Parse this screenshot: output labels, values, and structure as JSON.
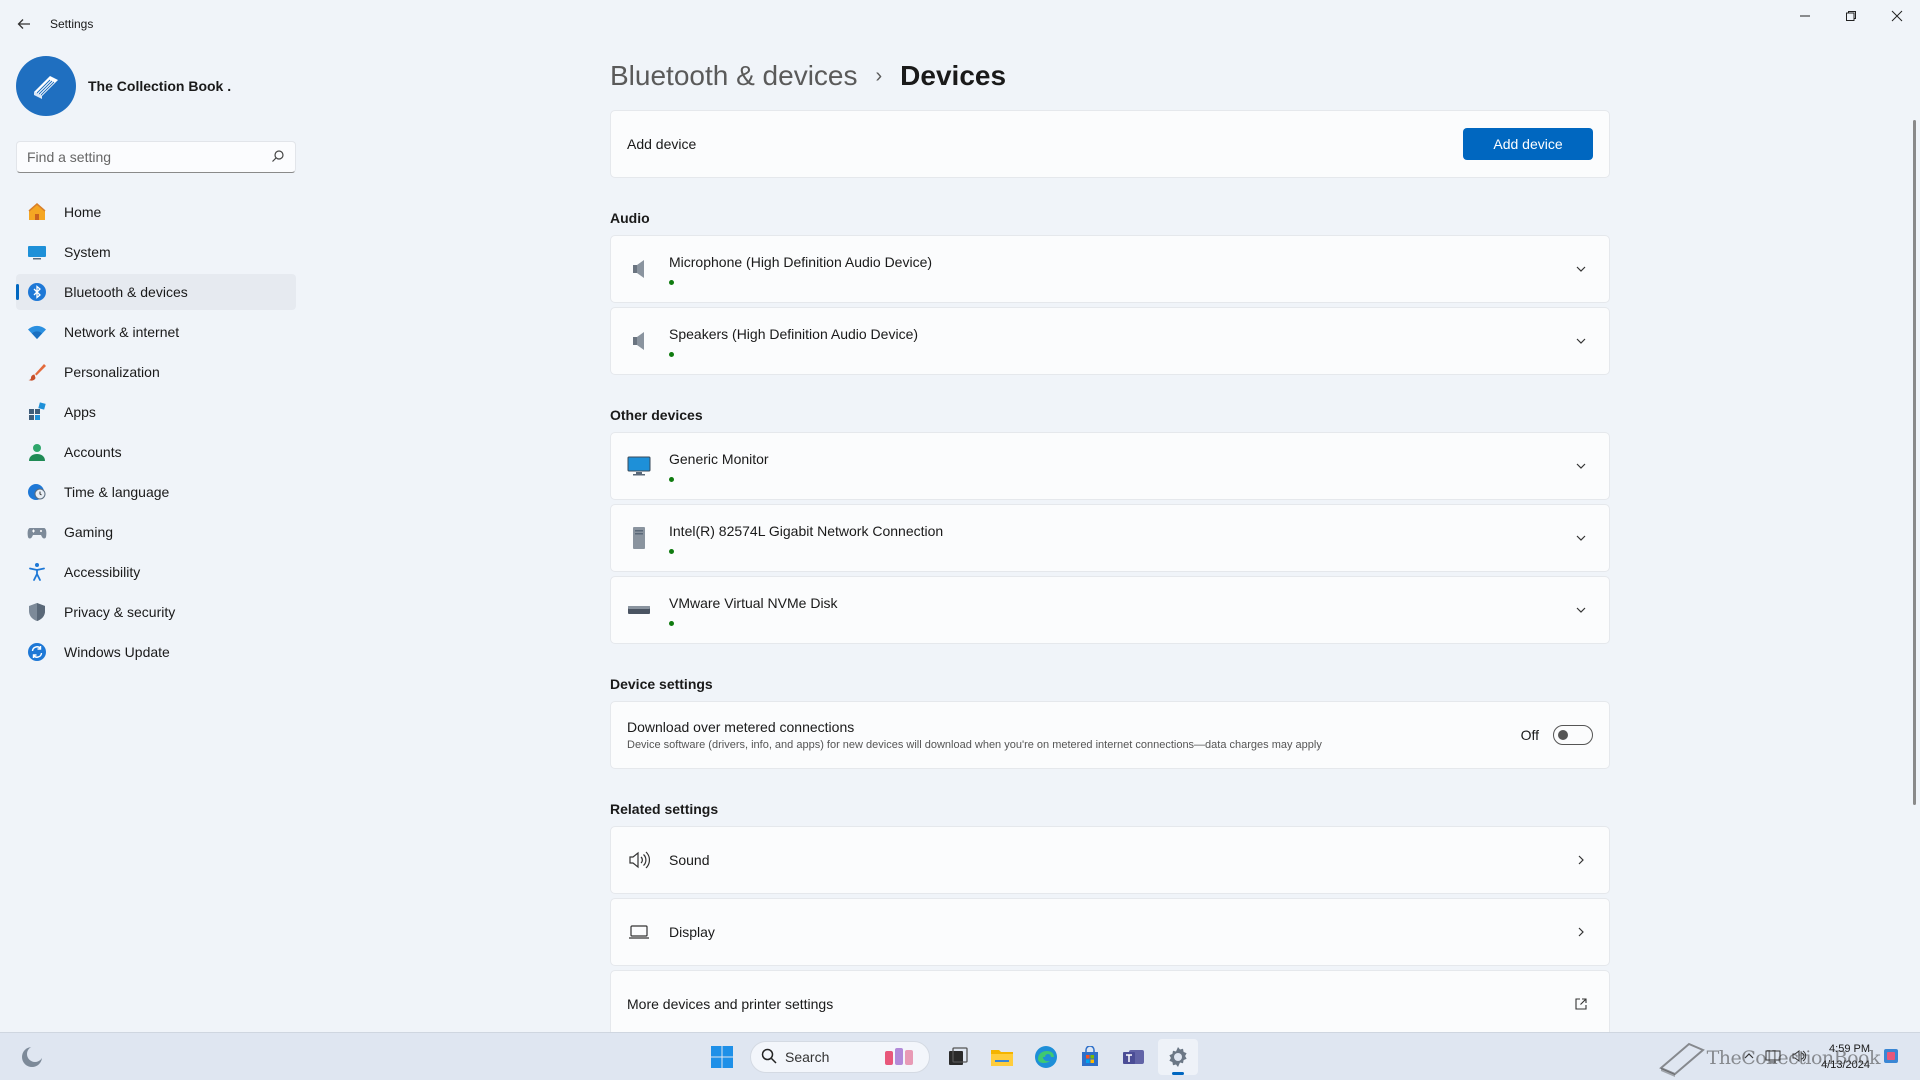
{
  "window": {
    "title": "Settings",
    "back_icon": "back-arrow-icon",
    "minimize_icon": "minimize-icon",
    "maximize_icon": "restore-icon",
    "close_icon": "close-icon"
  },
  "profile": {
    "name": "The Collection Book .",
    "avatar_icon": "book-logo-icon"
  },
  "search": {
    "placeholder": "Find a setting",
    "value": ""
  },
  "sidebar": {
    "items": [
      {
        "label": "Home",
        "icon": "home-icon",
        "active": false
      },
      {
        "label": "System",
        "icon": "system-icon",
        "active": false
      },
      {
        "label": "Bluetooth & devices",
        "icon": "bluetooth-icon",
        "active": true
      },
      {
        "label": "Network & internet",
        "icon": "wifi-icon",
        "active": false
      },
      {
        "label": "Personalization",
        "icon": "brush-icon",
        "active": false
      },
      {
        "label": "Apps",
        "icon": "apps-icon",
        "active": false
      },
      {
        "label": "Accounts",
        "icon": "account-icon",
        "active": false
      },
      {
        "label": "Time & language",
        "icon": "globe-clock-icon",
        "active": false
      },
      {
        "label": "Gaming",
        "icon": "gamepad-icon",
        "active": false
      },
      {
        "label": "Accessibility",
        "icon": "accessibility-icon",
        "active": false
      },
      {
        "label": "Privacy & security",
        "icon": "shield-icon",
        "active": false
      },
      {
        "label": "Windows Update",
        "icon": "update-icon",
        "active": false
      }
    ]
  },
  "breadcrumb": {
    "parent": "Bluetooth & devices",
    "separator": "›",
    "current": "Devices"
  },
  "add_device": {
    "label": "Add device",
    "button_label": "Add device"
  },
  "audio": {
    "title": "Audio",
    "devices": [
      {
        "name": "Microphone (High Definition Audio Device)",
        "icon": "speaker-icon",
        "status": "connected"
      },
      {
        "name": "Speakers (High Definition Audio Device)",
        "icon": "speaker-icon",
        "status": "connected"
      }
    ]
  },
  "other_devices": {
    "title": "Other devices",
    "devices": [
      {
        "name": "Generic Monitor",
        "icon": "monitor-icon",
        "status": "connected"
      },
      {
        "name": "Intel(R) 82574L Gigabit Network Connection",
        "icon": "tower-icon",
        "status": "connected"
      },
      {
        "name": "VMware Virtual NVMe Disk",
        "icon": "disk-icon",
        "status": "connected"
      }
    ]
  },
  "device_settings": {
    "title": "Device settings",
    "metered": {
      "title": "Download over metered connections",
      "description": "Device software (drivers, info, and apps) for new devices will download when you're on metered internet connections—data charges may apply",
      "toggle_label": "Off",
      "toggle_on": false
    }
  },
  "related_settings": {
    "title": "Related settings",
    "items": [
      {
        "label": "Sound",
        "icon": "sound-icon",
        "action": "chevron-right-icon"
      },
      {
        "label": "Display",
        "icon": "laptop-icon",
        "action": "chevron-right-icon"
      },
      {
        "label": "More devices and printer settings",
        "icon": "",
        "action": "external-link-icon"
      }
    ]
  },
  "taskbar": {
    "search_label": "Search",
    "apps": [
      "start-icon",
      "search-icon",
      "task-view-icon",
      "file-explorer-icon",
      "edge-icon",
      "store-icon",
      "teams-icon",
      "settings-icon"
    ],
    "active_app": "settings-icon",
    "clock": {
      "time": "4:59 PM",
      "date": "4/13/2024"
    },
    "watermark": "TheCollectionBook"
  },
  "colors": {
    "accent": "#0067c0",
    "status_green": "#0f7b0f",
    "background": "#f0f4f9"
  }
}
